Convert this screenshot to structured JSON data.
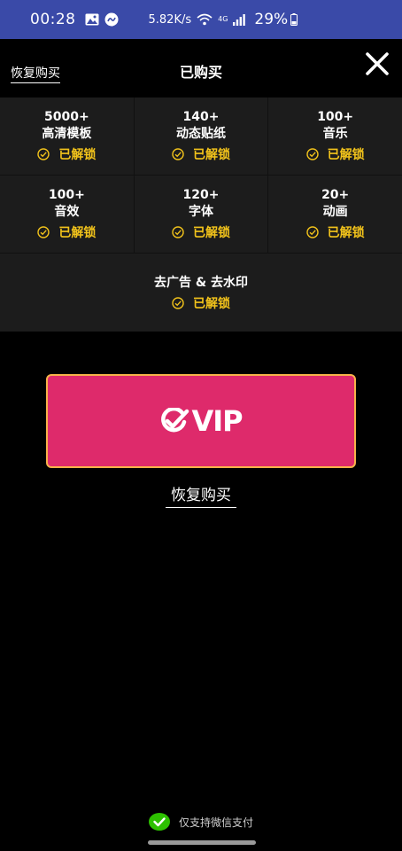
{
  "status_bar": {
    "time": "00:28",
    "speed": "5.82K/s",
    "network": "4G",
    "battery": "29%"
  },
  "header": {
    "restore_label": "恢复购买",
    "title": "已购买"
  },
  "features": {
    "unlocked_label": "已解锁",
    "row1": [
      {
        "count": "5000+",
        "name": "高清模板"
      },
      {
        "count": "140+",
        "name": "动态贴纸"
      },
      {
        "count": "100+",
        "name": "音乐"
      }
    ],
    "row2": [
      {
        "count": "100+",
        "name": "音效"
      },
      {
        "count": "120+",
        "name": "字体"
      },
      {
        "count": "20+",
        "name": "动画"
      }
    ],
    "wide": {
      "name": "去广告 & 去水印"
    }
  },
  "vip_button": {
    "label": "VIP"
  },
  "restore_bottom": {
    "label": "恢复购买"
  },
  "payment": {
    "note": "仅支持微信支付"
  },
  "colors": {
    "status_bar": "#3a4aa8",
    "vip_button": "#de2a6b",
    "vip_border": "#f7b24a",
    "unlocked": "#f2c31b",
    "wechat_green": "#2dc100"
  }
}
